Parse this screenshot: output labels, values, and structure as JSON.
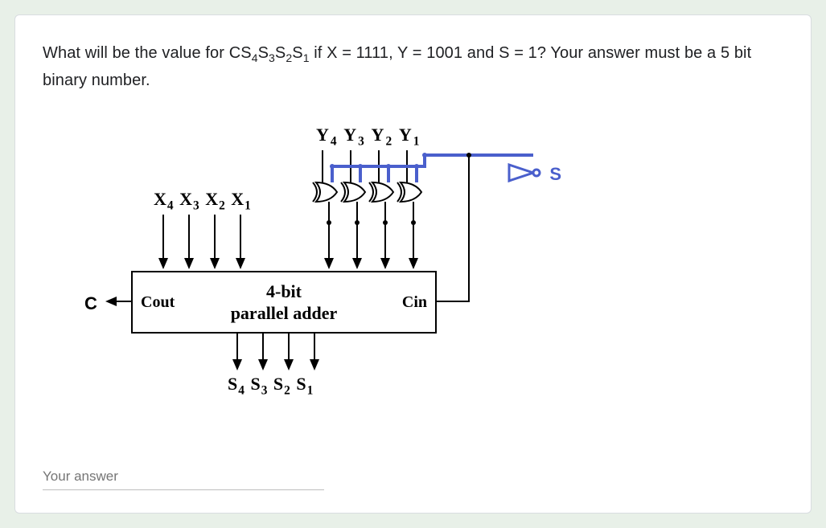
{
  "question": {
    "line_full": "What will be the value for CS₄S₃S₂S₁ if X = 1111, Y = 1001 and S = 1? Your answer must be a 5 bit binary number."
  },
  "diagram": {
    "y_labels": "Y₄ Y₃ Y₂ Y₁",
    "x_labels": "X₄ X₃ X₂ X₁",
    "s_labels": "S₄ S₃ S₂ S₁",
    "cout": "Cout",
    "cin": "Cin",
    "box_line1": "4-bit",
    "box_line2": "parallel adder",
    "c_symbol": "C",
    "s_symbol": "S"
  },
  "answer": {
    "placeholder": "Your answer",
    "value": ""
  }
}
